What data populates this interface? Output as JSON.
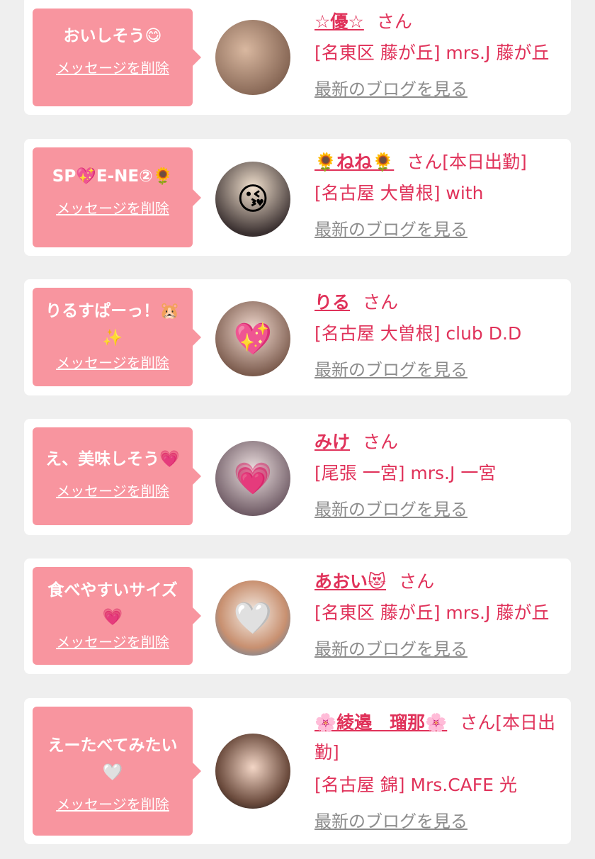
{
  "delete_label": "メッセージを削除",
  "blog_label": "最新のブログを見る",
  "san_label": "さん",
  "messages": [
    {
      "message": "おいしそう😋",
      "name": "☆優☆",
      "status": "",
      "shop": "[名東区 藤が丘] mrs.J 藤が丘",
      "avatar_icon": "person-photo"
    },
    {
      "message": "SP💖E-NE②🌻",
      "name": "🌻ねね🌻",
      "status": "[本日出勤]",
      "shop": "[名古屋 大曽根] with",
      "avatar_icon": "kiss-emoji"
    },
    {
      "message": "りるすぱーっ！🐹✨",
      "name": "りる",
      "status": "",
      "shop": "[名古屋 大曽根] club D.D",
      "avatar_icon": "heart-sticker"
    },
    {
      "message": "え、美味しそう💗",
      "name": "みけ",
      "status": "",
      "shop": "[尾張 一宮] mrs.J 一宮",
      "avatar_icon": "heart-sticker"
    },
    {
      "message": "食べやすいサイズ💗",
      "name": "あおい😻",
      "status": "",
      "shop": "[名東区 藤が丘] mrs.J 藤が丘",
      "avatar_icon": "white-heart-sticker"
    },
    {
      "message": "えーたべてみたい🤍",
      "name": "🌸綾邉　瑠那🌸",
      "status": "[本日出勤]",
      "shop": "[名古屋 錦] Mrs.CAFE 光",
      "avatar_icon": "person-photo"
    }
  ]
}
